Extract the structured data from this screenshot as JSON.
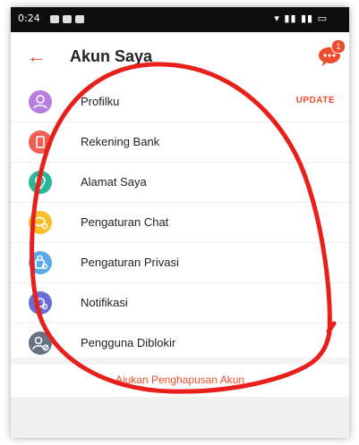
{
  "status_bar": {
    "time": "0:24"
  },
  "header": {
    "title": "Akun Saya",
    "chat_badge_count": "1"
  },
  "menu": [
    {
      "label": "Profilku",
      "badge": "UPDATE",
      "icon": "person-icon",
      "color": "#b77ee0"
    },
    {
      "label": "Rekening Bank",
      "icon": "bank-icon",
      "color": "#ee6054"
    },
    {
      "label": "Alamat Saya",
      "icon": "location-icon",
      "color": "#2bb79a"
    },
    {
      "label": "Pengaturan Chat",
      "icon": "chat-settings-icon",
      "color": "#f7c02b"
    },
    {
      "label": "Pengaturan Privasi",
      "icon": "privacy-icon",
      "color": "#5aa9ea"
    },
    {
      "label": "Notifikasi",
      "icon": "notification-icon",
      "color": "#6a6cd8"
    },
    {
      "label": "Pengguna Diblokir",
      "icon": "blocked-user-icon",
      "color": "#67717f"
    }
  ],
  "delete_account": {
    "label": "Ajukan Penghapusan Akun"
  },
  "colors": {
    "accent": "#ee4d2d",
    "annotation": "#e8201c"
  }
}
